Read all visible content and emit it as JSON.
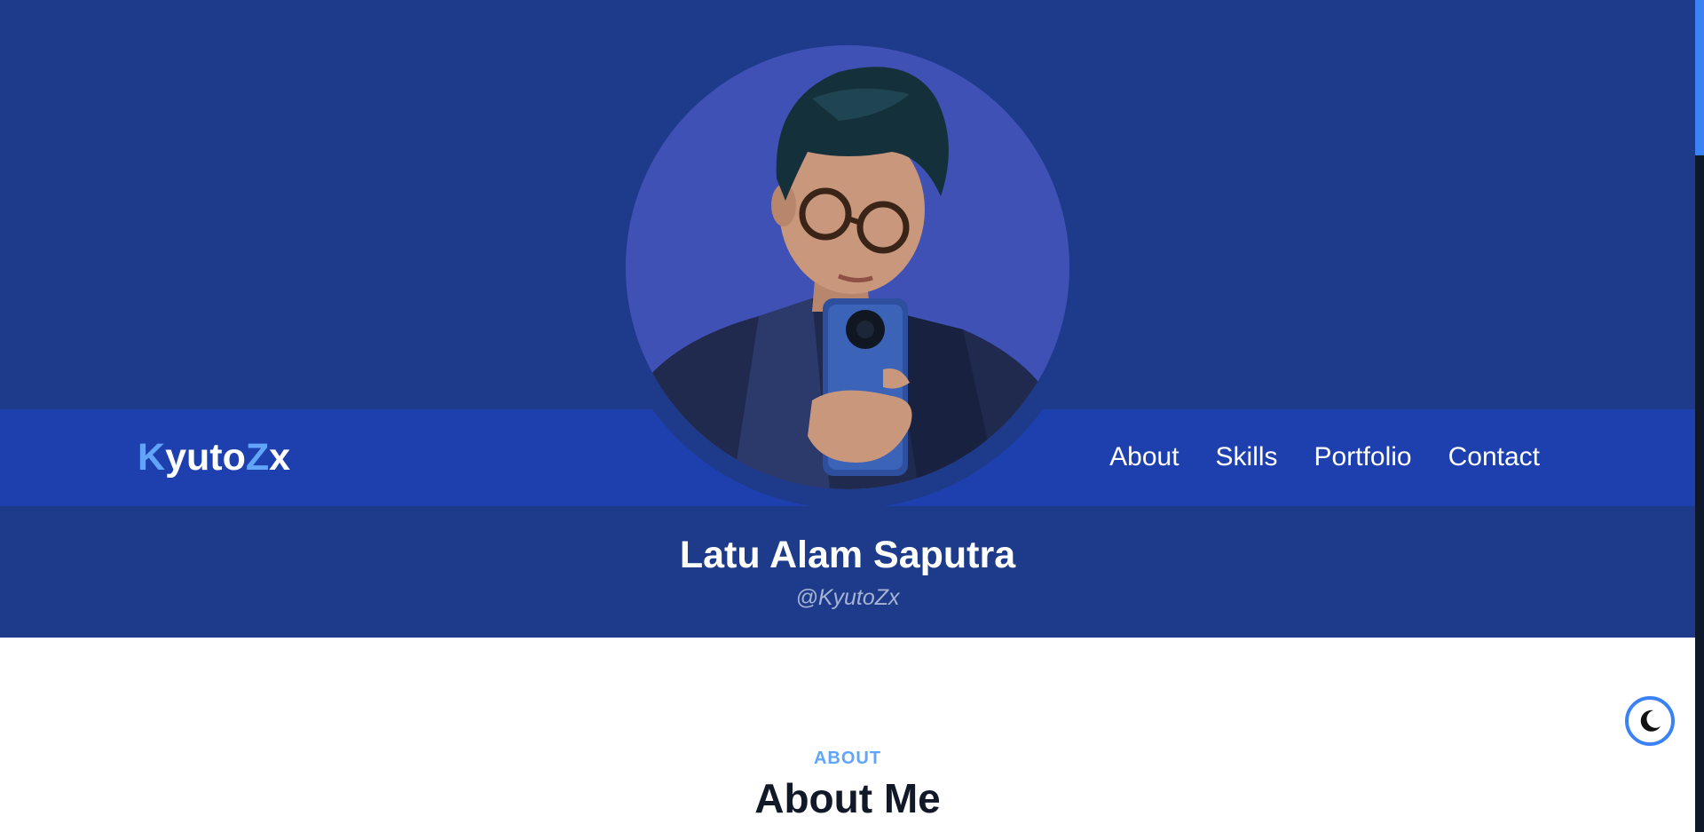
{
  "header": {
    "logo": {
      "part1_accent": "K",
      "part2": "yuto",
      "part3_accent": "Z",
      "part4": "x"
    },
    "nav": [
      {
        "label": "About"
      },
      {
        "label": "Skills"
      },
      {
        "label": "Portfolio"
      },
      {
        "label": "Contact"
      }
    ]
  },
  "profile": {
    "name": "Latu Alam Saputra",
    "handle": "@KyutoZx"
  },
  "about_section": {
    "eyebrow": "ABOUT",
    "title": "About Me"
  },
  "theme_toggle": {
    "icon": "moon-icon"
  },
  "colors": {
    "hero_bg": "#1e3a8a",
    "nav_bg": "#1e40af",
    "accent": "#60a5fa",
    "avatar_bg": "#3f51b5"
  }
}
